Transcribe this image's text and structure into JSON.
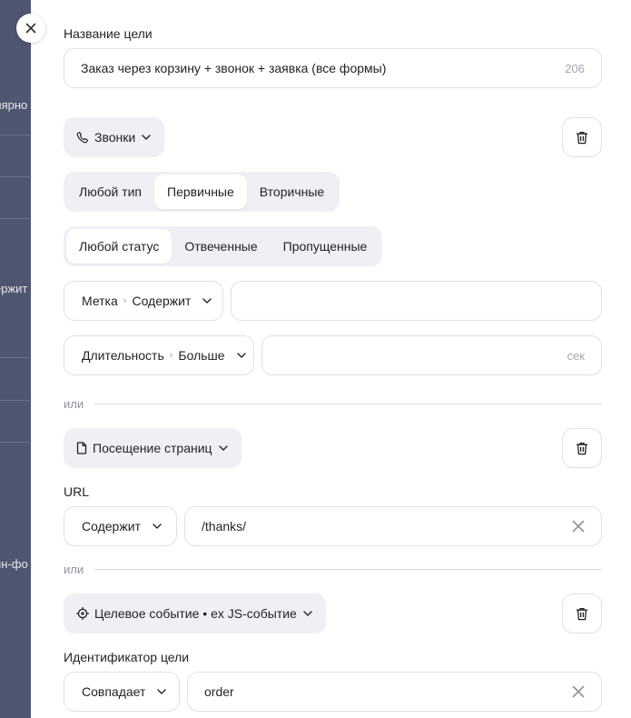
{
  "background": {
    "fragments": [
      "лярно",
      "ержит",
      "йн-фо"
    ]
  },
  "drawer": {
    "goal_name_label": "Название цели",
    "goal_name_value": "Заказ через корзину + звонок + заявка (все формы)",
    "goal_name_counter": "206",
    "or_label": "или",
    "conditions": {
      "calls": {
        "type_chip": "Звонки",
        "call_type": {
          "options": [
            "Любой тип",
            "Первичные",
            "Вторичные"
          ],
          "selected": "Первичные"
        },
        "call_status": {
          "options": [
            "Любой статус",
            "Отвеченные",
            "Пропущенные"
          ],
          "selected": "Любой статус"
        },
        "tag_filter": {
          "field": "Метка",
          "operator": "Содержит",
          "value": ""
        },
        "duration_filter": {
          "field": "Длительность",
          "operator": "Больше",
          "value": "",
          "unit": "сек"
        }
      },
      "page_visit": {
        "type_chip": "Посещение страниц",
        "url_label": "URL",
        "url_operator": "Содержит",
        "url_value": "/thanks/"
      },
      "target_event": {
        "type_chip": "Целевое событие • ex JS-событие",
        "id_label": "Идентификатор цели",
        "id_operator": "Совпадает",
        "id_value": "order"
      }
    }
  }
}
